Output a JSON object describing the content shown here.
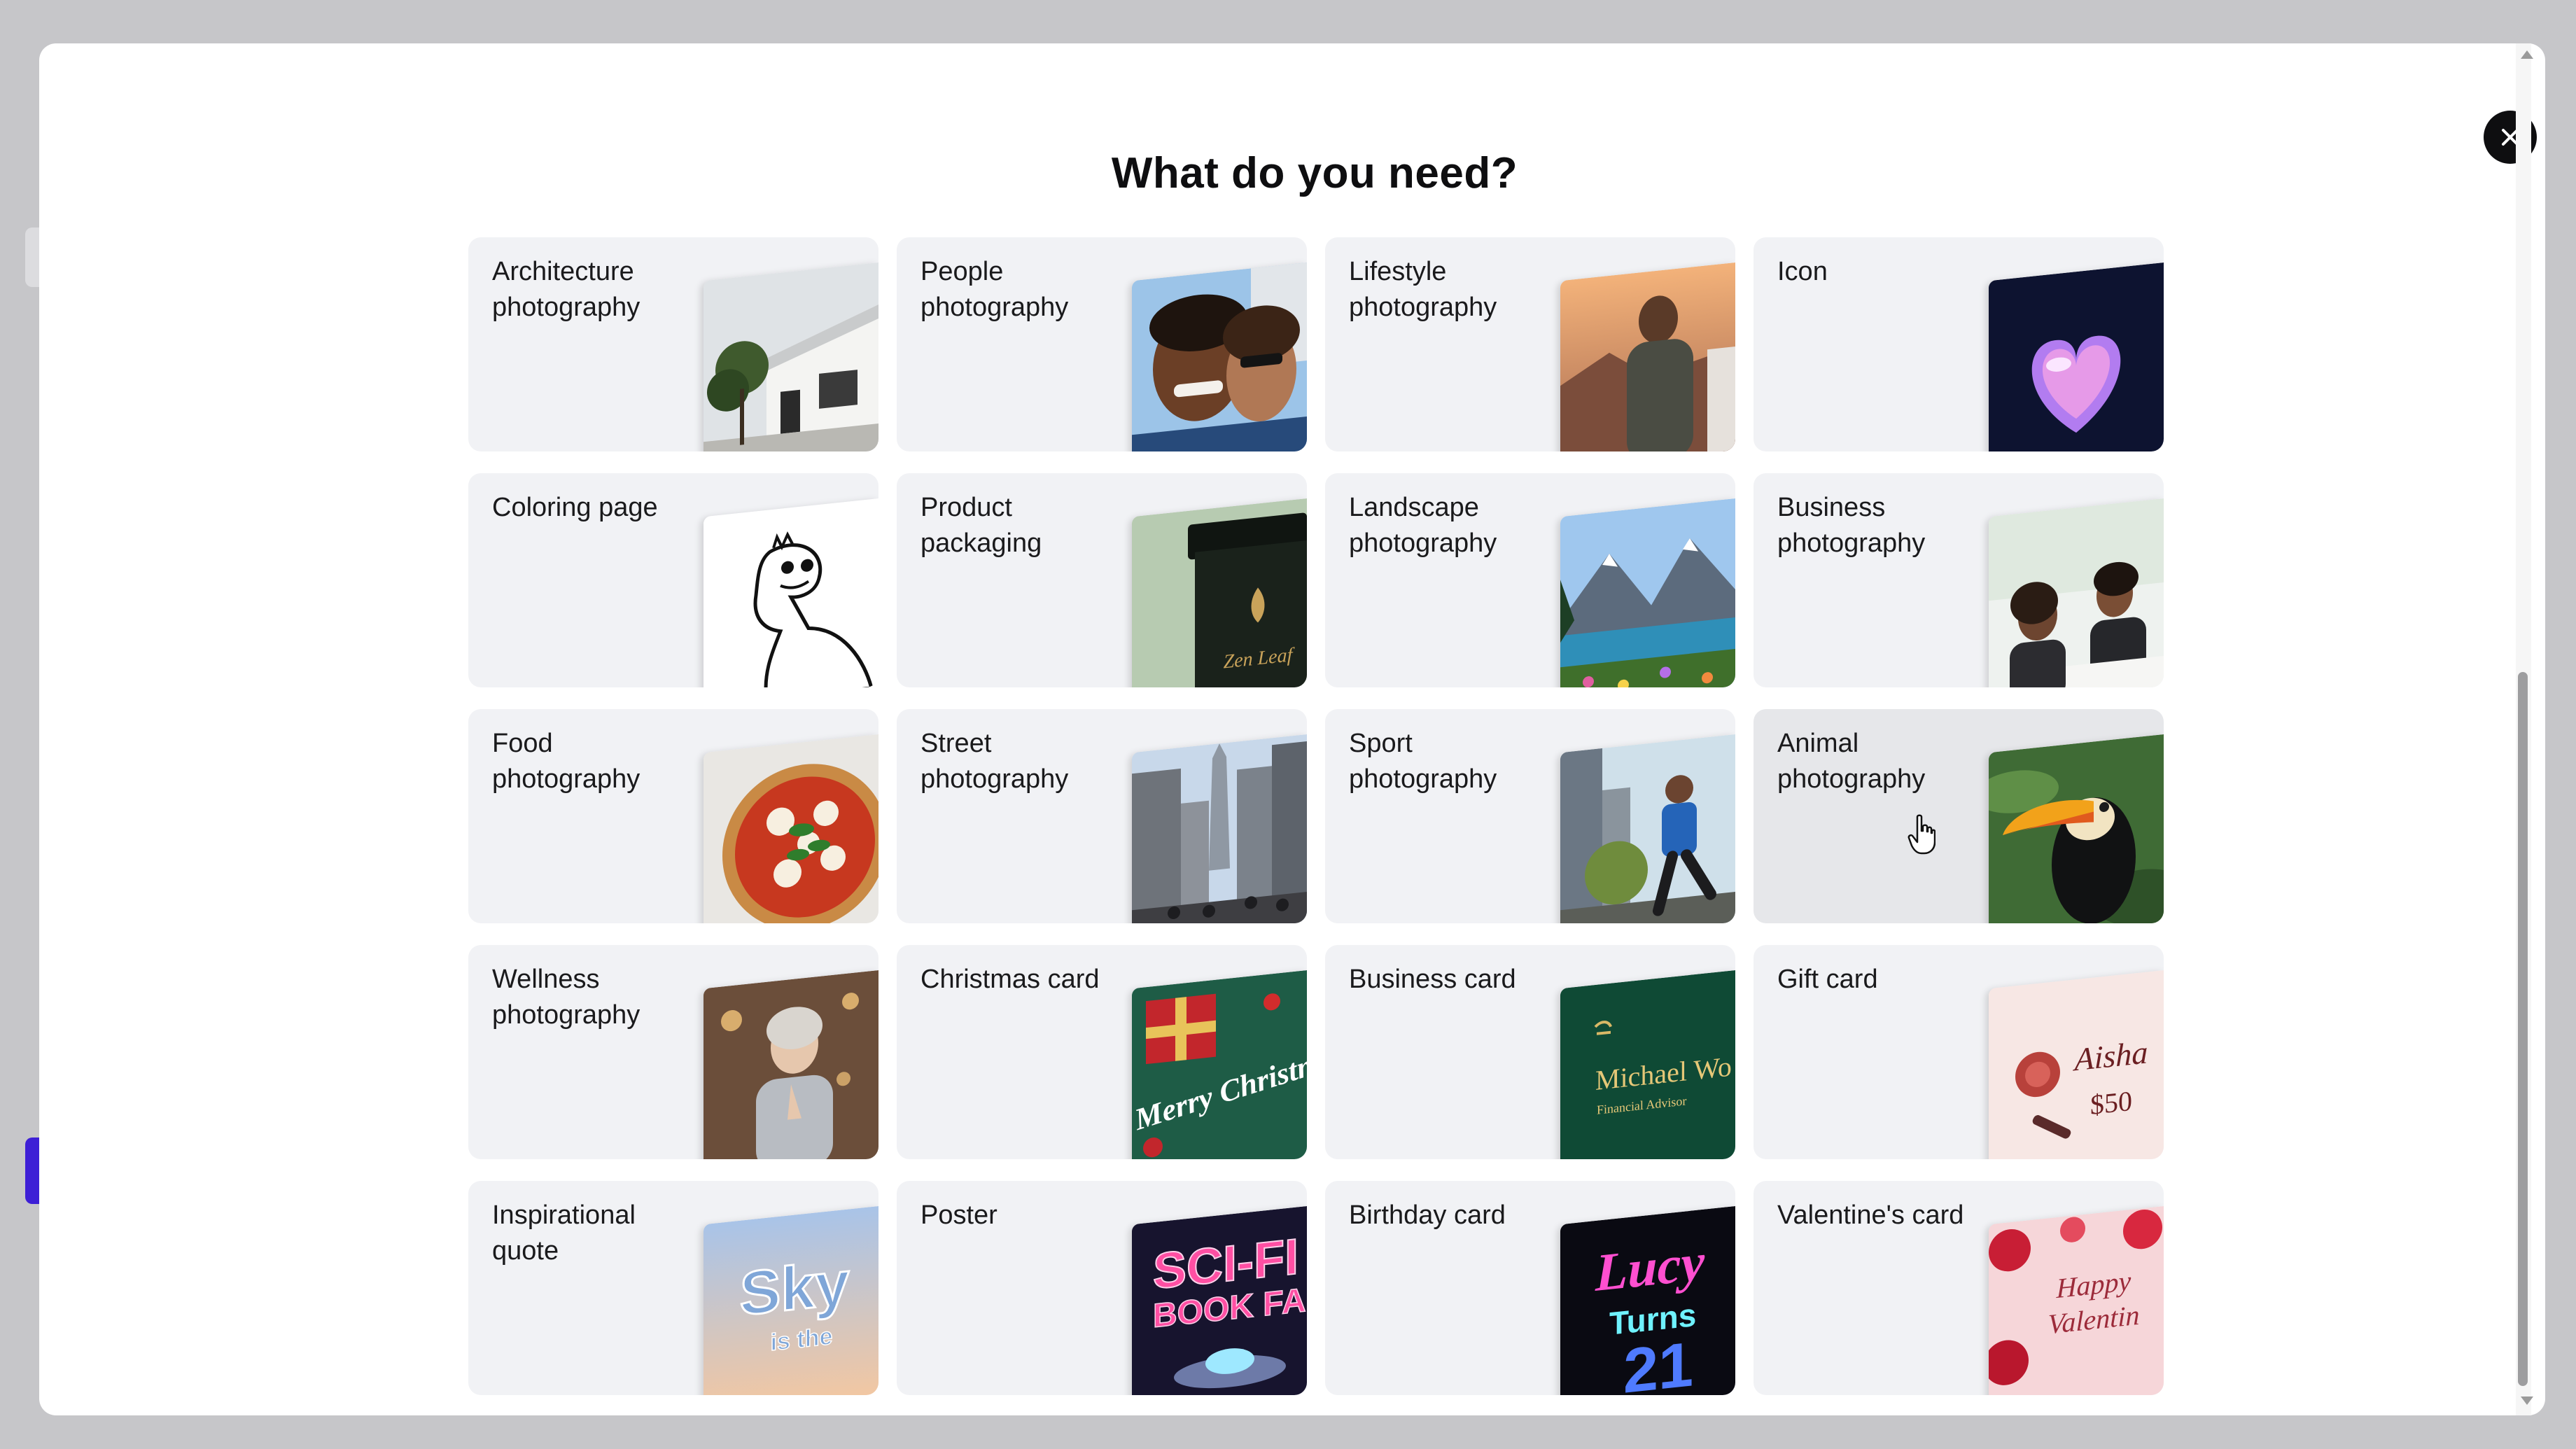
{
  "modal": {
    "title": "What do you need?",
    "close_icon": "close-icon"
  },
  "cards": [
    {
      "label": "Architecture\nphotography",
      "thumb": "architecture-thumbnail"
    },
    {
      "label": "People\nphotography",
      "thumb": "people-thumbnail"
    },
    {
      "label": "Lifestyle\nphotography",
      "thumb": "lifestyle-thumbnail"
    },
    {
      "label": "Icon",
      "thumb": "heart-icon-thumbnail"
    },
    {
      "label": "Coloring page",
      "thumb": "dinosaur-coloring-thumbnail"
    },
    {
      "label": "Product\npackaging",
      "thumb": "tea-jar-thumbnail",
      "thumb_text": "Zen Leaf"
    },
    {
      "label": "Landscape\nphotography",
      "thumb": "mountain-lake-thumbnail"
    },
    {
      "label": "Business\nphotography",
      "thumb": "meeting-thumbnail"
    },
    {
      "label": "Food\nphotography",
      "thumb": "pizza-thumbnail"
    },
    {
      "label": "Street\nphotography",
      "thumb": "city-street-thumbnail"
    },
    {
      "label": "Sport\nphotography",
      "thumb": "runner-thumbnail"
    },
    {
      "label": "Animal\nphotography",
      "thumb": "toucan-thumbnail"
    },
    {
      "label": "Wellness\nphotography",
      "thumb": "meditation-thumbnail"
    },
    {
      "label": "Christmas card",
      "thumb": "christmas-card-thumbnail",
      "thumb_text": "Merry Christm"
    },
    {
      "label": "Business card",
      "thumb": "business-card-thumbnail",
      "thumb_text": "Michael Wo",
      "thumb_subtext": "Financial Advisor"
    },
    {
      "label": "Gift card",
      "thumb": "gift-card-thumbnail",
      "thumb_text": "Aisha",
      "thumb_subtext": "$50"
    },
    {
      "label": "Inspirational\nquote",
      "thumb": "sky-quote-thumbnail",
      "thumb_text": "Sky",
      "thumb_subtext": "is the"
    },
    {
      "label": "Poster",
      "thumb": "scifi-poster-thumbnail",
      "thumb_text": "SCI-FI",
      "thumb_subtext": "BOOK FA"
    },
    {
      "label": "Birthday card",
      "thumb": "birthday-card-thumbnail",
      "thumb_text": "Lucy",
      "thumb_subtext": "Turns",
      "thumb_number": "21"
    },
    {
      "label": "Valentine's card",
      "thumb": "valentine-card-thumbnail",
      "thumb_text": "Happy",
      "thumb_subtext": "Valentin"
    }
  ],
  "colors": {
    "overlay": "#c6c6c9",
    "card_bg": "#f1f2f5",
    "card_hover": "#e6e7ea",
    "close_button": "#0e0e10",
    "accent_purple": "#3d1fd6"
  }
}
